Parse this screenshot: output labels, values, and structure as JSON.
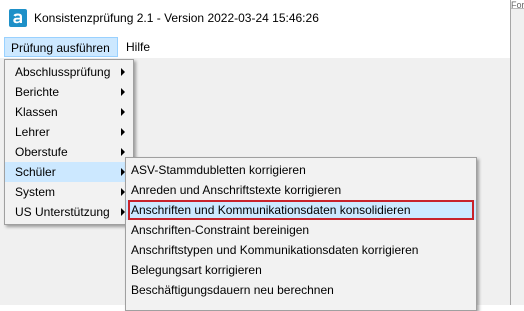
{
  "window": {
    "title": "Konsistenzprüfung 2.1 - Version 2022-03-24 15:46:26",
    "bg_snippet": "Formel für EMS"
  },
  "menubar": {
    "items": [
      {
        "label": "Prüfung ausführen",
        "active": true
      },
      {
        "label": "Hilfe",
        "active": false
      }
    ]
  },
  "main_menu": {
    "items": [
      {
        "label": "Abschlussprüfung",
        "has_submenu": true
      },
      {
        "label": "Berichte",
        "has_submenu": true
      },
      {
        "label": "Klassen",
        "has_submenu": true
      },
      {
        "label": "Lehrer",
        "has_submenu": true
      },
      {
        "label": "Oberstufe",
        "has_submenu": true
      },
      {
        "label": "Schüler",
        "has_submenu": true,
        "hovered": true
      },
      {
        "label": "System",
        "has_submenu": true
      },
      {
        "label": "US Unterstützung",
        "has_submenu": true
      }
    ]
  },
  "submenu_schueler": {
    "items": [
      {
        "label": "ASV-Stammdubletten korrigieren"
      },
      {
        "label": "Anreden und Anschriftstexte korrigieren"
      },
      {
        "label": "Anschriften und Kommunikationsdaten konsolidieren",
        "hovered": true,
        "highlighted": true
      },
      {
        "label": "Anschriften-Constraint bereinigen"
      },
      {
        "label": "Anschriftstypen und Kommunikationsdaten korrigieren"
      },
      {
        "label": "Belegungsart korrigieren"
      },
      {
        "label": "Beschäftigungsdauern neu berechnen"
      }
    ]
  },
  "colors": {
    "hover": "#cce8ff",
    "highlight_border": "#c8222b",
    "app_icon": "#1e90c8"
  }
}
